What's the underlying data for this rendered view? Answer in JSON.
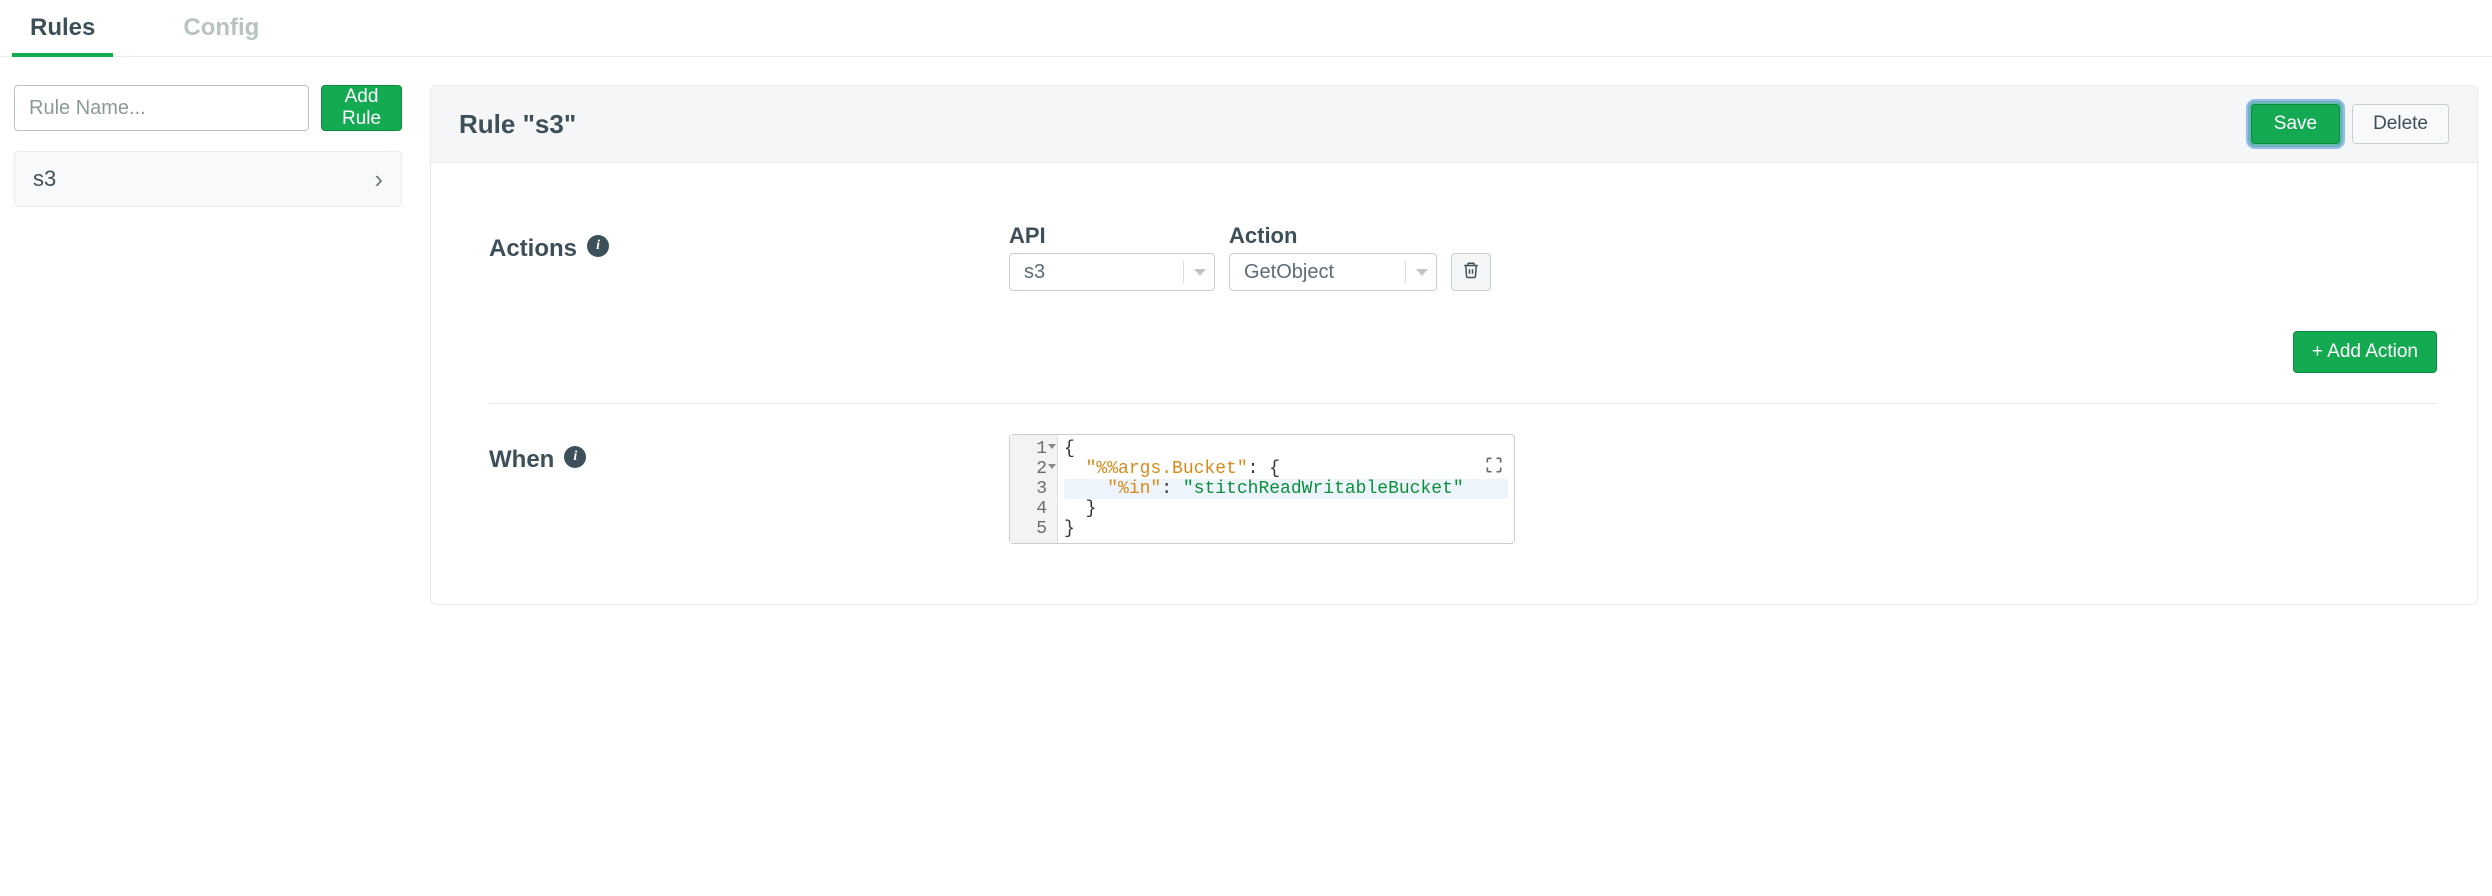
{
  "tabs": {
    "rules": "Rules",
    "config": "Config"
  },
  "sidebar": {
    "rule_name_placeholder": "Rule Name...",
    "add_rule_label": "Add Rule",
    "items": [
      {
        "name": "s3"
      }
    ]
  },
  "panel": {
    "title": "Rule \"s3\"",
    "save_label": "Save",
    "delete_label": "Delete"
  },
  "sections": {
    "actions_label": "Actions",
    "when_label": "When",
    "add_action_label": "+ Add Action",
    "api_label": "API",
    "action_label": "Action",
    "api_value": "s3",
    "action_value": "GetObject"
  },
  "editor": {
    "lines": [
      "1",
      "2",
      "3",
      "4",
      "5"
    ],
    "code": {
      "l1": "{",
      "l2_key": "\"%%args.Bucket\"",
      "l2_rest": ": {",
      "l3_key": "\"%in\"",
      "l3_sep": ": ",
      "l3_val": "\"stitchReadWritableBucket\"",
      "l4": "}",
      "l5": "}"
    }
  }
}
